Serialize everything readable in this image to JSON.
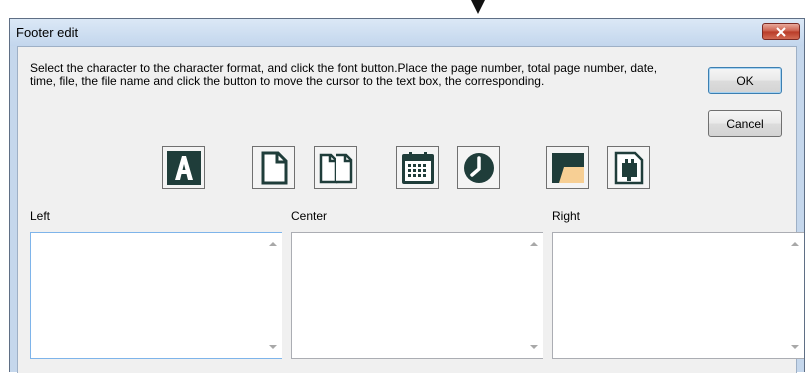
{
  "dialog": {
    "title": "Footer edit",
    "instructions": "Select the character to the character format, and click the font button.Place the page number, total page number, date, time, file, the file name and click the button to move the cursor to the text box, the corresponding.",
    "ok_label": "OK",
    "cancel_label": "Cancel"
  },
  "toolbar": {
    "icons": [
      "font-icon",
      "page-number-icon",
      "total-pages-icon",
      "date-icon",
      "time-icon",
      "file-path-icon",
      "file-name-icon"
    ]
  },
  "sections": {
    "left_label": "Left",
    "center_label": "Center",
    "right_label": "Right",
    "left_value": "",
    "center_value": "",
    "right_value": ""
  },
  "colors": {
    "title_bar": "#c3d6ed",
    "close_button": "#c95a47",
    "icon_dark": "#1f3d3a",
    "folder_fill": "#f7cf94"
  }
}
